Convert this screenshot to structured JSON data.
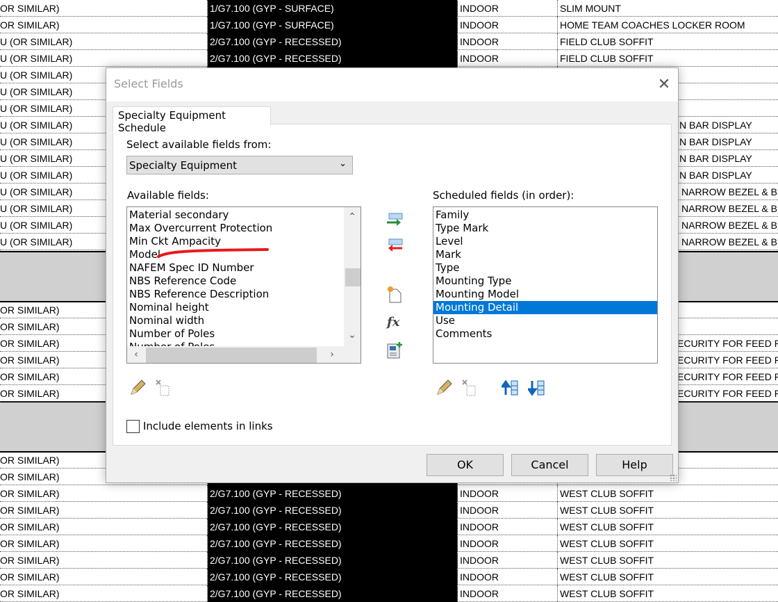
{
  "schedule": {
    "top_rows": [
      {
        "c1": "OR SIMILAR)",
        "c2": "1/G7.100 (GYP - SURFACE)",
        "c3": "INDOOR",
        "c4": "SLIM MOUNT"
      },
      {
        "c1": "OR SIMILAR)",
        "c2": "1/G7.100 (GYP - SURFACE)",
        "c3": "INDOOR",
        "c4": "HOME TEAM COACHES LOCKER ROOM"
      },
      {
        "c1": "U (OR SIMILAR)",
        "c2": "2/G7.100 (GYP - RECESSED)",
        "c3": "INDOOR",
        "c4": "FIELD CLUB SOFFIT"
      },
      {
        "c1": "U (OR SIMILAR)",
        "c2": "2/G7.100 (GYP - RECESSED)",
        "c3": "INDOOR",
        "c4": "FIELD CLUB SOFFIT"
      },
      {
        "c1": "U (OR SIMILAR)",
        "c2": "",
        "c3": "",
        "c4": ""
      },
      {
        "c1": "U (OR SIMILAR)",
        "c2": "",
        "c3": "",
        "c4": ""
      },
      {
        "c1": "U (OR SIMILAR)",
        "c2": "",
        "c3": "",
        "c4": ""
      },
      {
        "c1": "U (OR SIMILAR)",
        "c2": "",
        "c3": "",
        "c4": "N BAR DISPLAY"
      },
      {
        "c1": "U (OR SIMILAR)",
        "c2": "",
        "c3": "",
        "c4": "N BAR DISPLAY"
      },
      {
        "c1": "U (OR SIMILAR)",
        "c2": "",
        "c3": "",
        "c4": "N BAR DISPLAY"
      },
      {
        "c1": "U (OR SIMILAR)",
        "c2": "",
        "c3": "",
        "c4": "N BAR DISPLAY"
      },
      {
        "c1": "U (OR SIMILAR)",
        "c2": "",
        "c3": "",
        "c4": "NARROW BEZEL & BU"
      },
      {
        "c1": "U (OR SIMILAR)",
        "c2": "",
        "c3": "",
        "c4": "NARROW BEZEL & BU"
      },
      {
        "c1": "U (OR SIMILAR)",
        "c2": "",
        "c3": "",
        "c4": "NARROW BEZEL & BU"
      },
      {
        "c1": "U (OR SIMILAR)",
        "c2": "",
        "c3": "",
        "c4": "NARROW BEZEL & BU"
      }
    ],
    "mid_rows": [
      {
        "c1": "OR SIMILAR)",
        "c2": "",
        "c3": "",
        "c4": ""
      },
      {
        "c1": "OR SIMILAR)",
        "c2": "",
        "c3": "",
        "c4": ""
      },
      {
        "c1": "OR SIMILAR)",
        "c2": "",
        "c3": "",
        "c4": "ECURITY FOR FEED RE"
      },
      {
        "c1": "OR SIMILAR)",
        "c2": "",
        "c3": "",
        "c4": "ECURITY FOR FEED RE"
      },
      {
        "c1": "OR SIMILAR)",
        "c2": "",
        "c3": "",
        "c4": "ECURITY FOR FEED RE"
      },
      {
        "c1": "OR SIMILAR)",
        "c2": "",
        "c3": "",
        "c4": "ECURITY FOR FEED RE"
      }
    ],
    "bottom_rows": [
      {
        "c1": "OR SIMILAR)",
        "c2": "",
        "c3": "",
        "c4": ""
      },
      {
        "c1": "OR SIMILAR)",
        "c2": "",
        "c3": "",
        "c4": ""
      },
      {
        "c1": "OR SIMILAR)",
        "c2": "2/G7.100 (GYP - RECESSED)",
        "c3": "INDOOR",
        "c4": "WEST CLUB SOFFIT"
      },
      {
        "c1": "OR SIMILAR)",
        "c2": "2/G7.100 (GYP - RECESSED)",
        "c3": "INDOOR",
        "c4": "WEST CLUB SOFFIT"
      },
      {
        "c1": "OR SIMILAR)",
        "c2": "2/G7.100 (GYP - RECESSED)",
        "c3": "INDOOR",
        "c4": "WEST CLUB SOFFIT"
      },
      {
        "c1": "OR SIMILAR)",
        "c2": "2/G7.100 (GYP - RECESSED)",
        "c3": "INDOOR",
        "c4": "WEST CLUB SOFFIT"
      },
      {
        "c1": "OR SIMILAR)",
        "c2": "2/G7.100 (GYP - RECESSED)",
        "c3": "INDOOR",
        "c4": "WEST CLUB SOFFIT"
      },
      {
        "c1": "OR SIMILAR)",
        "c2": "2/G7.100 (GYP - RECESSED)",
        "c3": "INDOOR",
        "c4": "WEST CLUB SOFFIT"
      },
      {
        "c1": "OR SIMILAR)",
        "c2": "2/G7.100 (GYP - RECESSED)",
        "c3": "INDOOR",
        "c4": "WEST CLUB SOFFIT"
      }
    ]
  },
  "dialog": {
    "title": "Select Fields",
    "tab": "Specialty Equipment Schedule",
    "source_label": "Select available fields from:",
    "source_value": "Specialty Equipment",
    "available_label": "Available fields:",
    "available_fields": [
      "Material secondary",
      "Max Overcurrent Protection",
      "Min Ckt Ampacity",
      "Model",
      "NAFEM Spec ID Number",
      "NBS Reference Code",
      "NBS Reference Description",
      "Nominal height",
      "Nominal width",
      "Number of Poles",
      "Number of Poles"
    ],
    "scheduled_label": "Scheduled fields (in order):",
    "scheduled_fields": [
      "Family",
      "Type Mark",
      "Level",
      "Mark",
      "Type",
      "Mounting Type",
      "Mounting Model",
      "Mounting Detail",
      "Use",
      "Comments"
    ],
    "selected_scheduled": "Mounting Detail",
    "include_links_label": "Include elements in links",
    "include_links_checked": false,
    "ok": "OK",
    "cancel": "Cancel",
    "help": "Help",
    "selection_color": "#0078d7",
    "annotation_color": "#e8191c"
  }
}
